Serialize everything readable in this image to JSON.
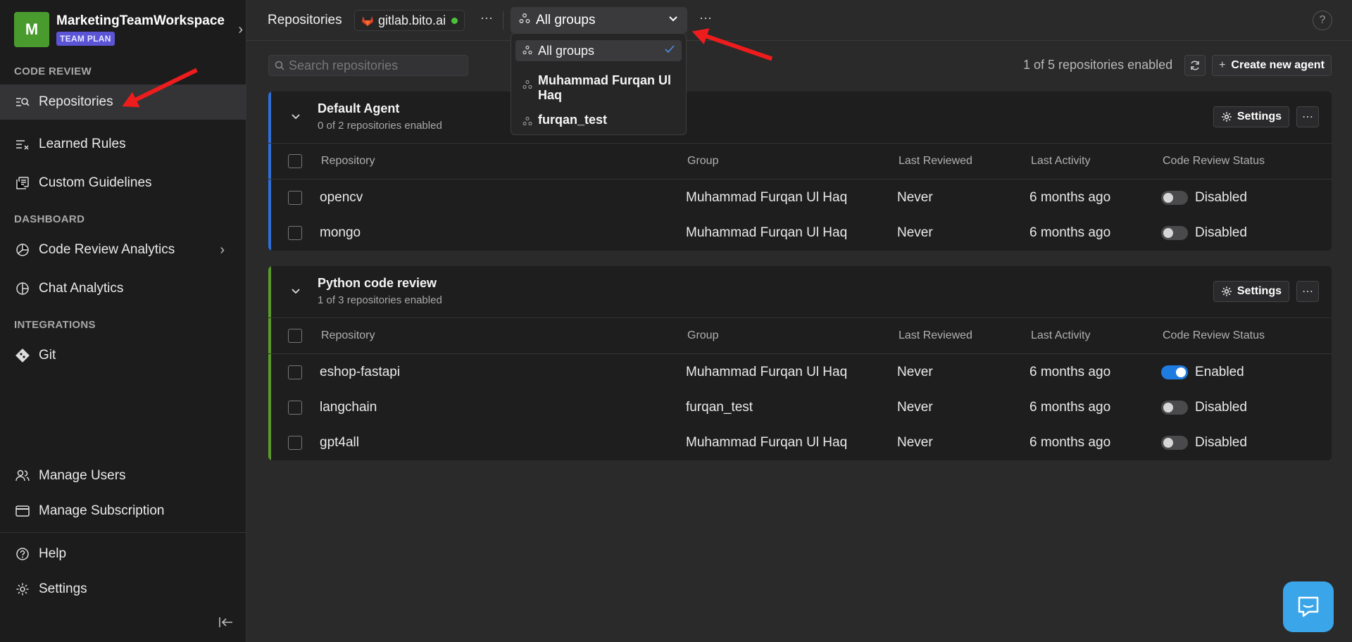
{
  "workspace": {
    "initial": "M",
    "name": "MarketingTeamWorkspace",
    "plan": "TEAM PLAN"
  },
  "sidebar": {
    "sections": {
      "code_review": "CODE REVIEW",
      "dashboard": "DASHBOARD",
      "integrations": "INTEGRATIONS"
    },
    "items": [
      {
        "label": "Repositories",
        "icon": "repo-search-icon",
        "active": true
      },
      {
        "label": "Learned Rules",
        "icon": "rules-icon"
      },
      {
        "label": "Custom Guidelines",
        "icon": "guidelines-icon"
      },
      {
        "label": "Code Review Analytics",
        "icon": "analytics-icon"
      },
      {
        "label": "Chat Analytics",
        "icon": "chat-analytics-icon"
      },
      {
        "label": "Git",
        "icon": "git-icon"
      },
      {
        "label": "Manage Users",
        "icon": "users-icon"
      },
      {
        "label": "Manage Subscription",
        "icon": "card-icon"
      },
      {
        "label": "Help",
        "icon": "help-icon"
      },
      {
        "label": "Settings",
        "icon": "gear-icon"
      }
    ]
  },
  "topbar": {
    "title": "Repositories",
    "git_host": "gitlab.bito.ai",
    "group_select": "All groups",
    "help": "?"
  },
  "group_menu": {
    "items": [
      "All groups",
      "Muhammad Furqan Ul Haq",
      "furqan_test"
    ],
    "selected": "All groups"
  },
  "toolbar": {
    "search_placeholder": "Search repositories",
    "count_text": "1 of 5 repositories enabled",
    "create_label": "Create new agent"
  },
  "table_headers": {
    "repository": "Repository",
    "group": "Group",
    "last_reviewed": "Last Reviewed",
    "last_activity": "Last Activity",
    "status": "Code Review Status"
  },
  "agents": [
    {
      "title": "Default Agent",
      "subtitle": "0 of 2 repositories enabled",
      "settings_label": "Settings",
      "accent": "#2f6fd6",
      "rows": [
        {
          "repo": "opencv",
          "group": "Muhammad Furqan Ul Haq",
          "reviewed": "Never",
          "activity": "6 months ago",
          "status": "Disabled",
          "enabled": false
        },
        {
          "repo": "mongo",
          "group": "Muhammad Furqan Ul Haq",
          "reviewed": "Never",
          "activity": "6 months ago",
          "status": "Disabled",
          "enabled": false
        }
      ]
    },
    {
      "title": "Python code review",
      "subtitle": "1 of 3 repositories enabled",
      "settings_label": "Settings",
      "accent": "#5a9a2a",
      "rows": [
        {
          "repo": "eshop-fastapi",
          "group": "Muhammad Furqan Ul Haq",
          "reviewed": "Never",
          "activity": "6 months ago",
          "status": "Enabled",
          "enabled": true
        },
        {
          "repo": "langchain",
          "group": "furqan_test",
          "reviewed": "Never",
          "activity": "6 months ago",
          "status": "Disabled",
          "enabled": false
        },
        {
          "repo": "gpt4all",
          "group": "Muhammad Furqan Ul Haq",
          "reviewed": "Never",
          "activity": "6 months ago",
          "status": "Disabled",
          "enabled": false
        }
      ]
    }
  ],
  "colors": {
    "annotation_arrow": "#ee1c1c",
    "chat_widget": "#3aa5e8"
  }
}
